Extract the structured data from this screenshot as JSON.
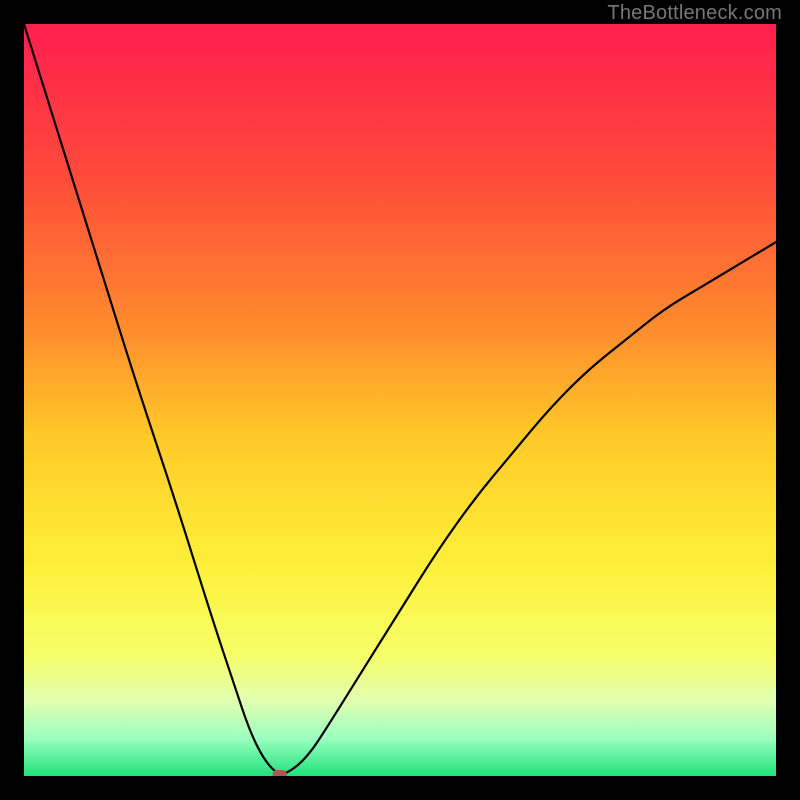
{
  "watermark": "TheBottleneck.com",
  "chart_data": {
    "type": "line",
    "title": "",
    "xlabel": "",
    "ylabel": "",
    "xlim": [
      0,
      100
    ],
    "ylim": [
      0,
      100
    ],
    "grid": false,
    "legend": false,
    "series": [
      {
        "name": "bottleneck-curve",
        "x": [
          0,
          5,
          10,
          15,
          20,
          25,
          28,
          30,
          32,
          34,
          36,
          38,
          40,
          45,
          50,
          55,
          60,
          65,
          70,
          75,
          80,
          85,
          90,
          95,
          100
        ],
        "y": [
          100,
          84,
          68,
          52,
          37,
          21,
          12,
          6,
          2,
          0,
          1,
          3,
          6,
          14,
          22,
          30,
          37,
          43,
          49,
          54,
          58,
          62,
          65,
          68,
          71
        ]
      }
    ],
    "marker": {
      "x": 34,
      "y": 0,
      "color": "#b85450"
    },
    "gradient_stops": [
      {
        "offset": 0.0,
        "color": "#ff1e4f"
      },
      {
        "offset": 0.2,
        "color": "#ff4a3a"
      },
      {
        "offset": 0.4,
        "color": "#ff8a2e"
      },
      {
        "offset": 0.55,
        "color": "#ffca28"
      },
      {
        "offset": 0.72,
        "color": "#fff03a"
      },
      {
        "offset": 0.84,
        "color": "#f6ff6a"
      },
      {
        "offset": 0.9,
        "color": "#e2ffb0"
      },
      {
        "offset": 0.95,
        "color": "#9affc0"
      },
      {
        "offset": 1.0,
        "color": "#20e27a"
      }
    ]
  }
}
